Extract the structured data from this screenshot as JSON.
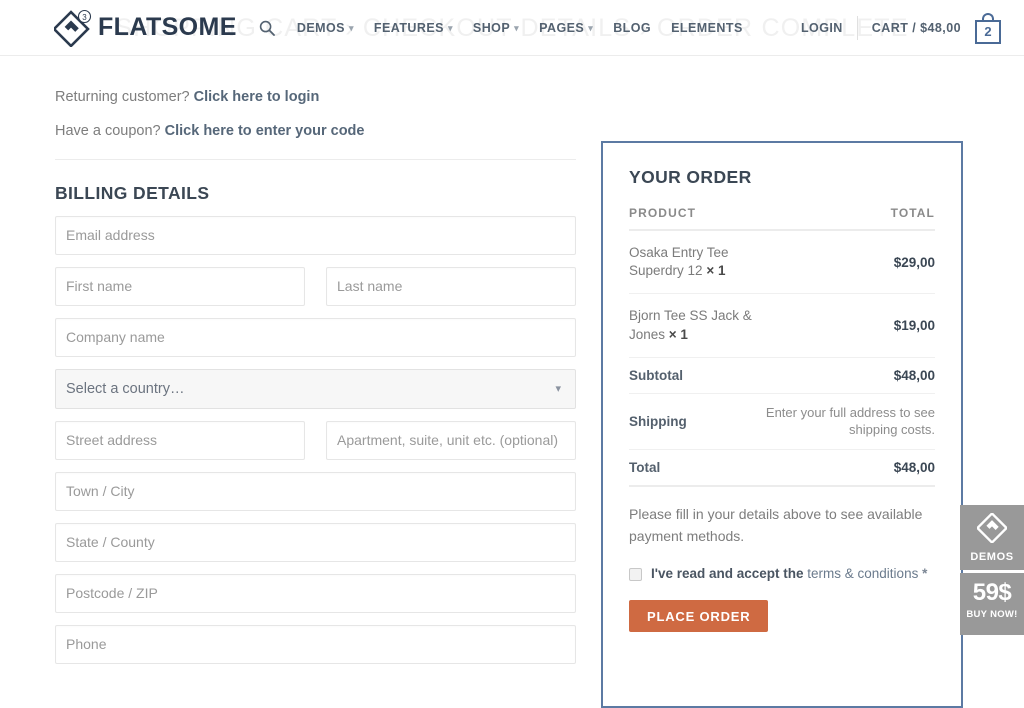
{
  "page": {
    "background_breadcrumb": "SHOPPING CART › CHECKOUT DETAILS › ORDER COMPLETE"
  },
  "header": {
    "logo_text": "FLATSOME",
    "logo_badge": "3",
    "search_icon": "search-icon",
    "nav": [
      {
        "label": "DEMOS",
        "has_caret": true
      },
      {
        "label": "FEATURES",
        "has_caret": true
      },
      {
        "label": "SHOP",
        "has_caret": true
      },
      {
        "label": "PAGES",
        "has_caret": true
      },
      {
        "label": "BLOG",
        "has_caret": false
      },
      {
        "label": "ELEMENTS",
        "has_caret": false
      }
    ],
    "login_label": "LOGIN",
    "cart_label": "CART / $48,00",
    "cart_count": "2"
  },
  "checkout": {
    "returning_prefix": "Returning customer? ",
    "returning_link": "Click here to login",
    "coupon_prefix": "Have a coupon? ",
    "coupon_link": "Click here to enter your code",
    "billing_title": "BILLING DETAILS",
    "fields": {
      "email": "Email address",
      "first_name": "First name",
      "last_name": "Last name",
      "company": "Company name",
      "country": "Select a country…",
      "street": "Street address",
      "apartment": "Apartment, suite, unit etc. (optional)",
      "city": "Town / City",
      "state": "State / County",
      "postcode": "Postcode / ZIP",
      "phone": "Phone"
    }
  },
  "order": {
    "title": "YOUR ORDER",
    "col_product": "PRODUCT",
    "col_total": "TOTAL",
    "items": [
      {
        "name": "Osaka Entry Tee Superdry 12",
        "qty": "× 1",
        "total": "$29,00"
      },
      {
        "name": "Bjorn Tee SS Jack & Jones",
        "qty": "× 1",
        "total": "$19,00"
      }
    ],
    "subtotal_label": "Subtotal",
    "subtotal_value": "$48,00",
    "shipping_label": "Shipping",
    "shipping_note": "Enter your full address to see shipping costs.",
    "total_label": "Total",
    "total_value": "$48,00",
    "payment_note": "Please fill in your details above to see available payment methods.",
    "terms_prefix": "I've read and accept the ",
    "terms_link": "terms & conditions",
    "terms_required": " *",
    "place_order_label": "PLACE ORDER"
  },
  "side_widgets": {
    "demos_label": "DEMOS",
    "price": "59$",
    "buy_label": "BUY NOW!"
  },
  "colors": {
    "accent_orange": "#cf6a42",
    "order_border_blue": "#5c7aa3",
    "nav_text": "#536170",
    "widget_gray": "#999999"
  }
}
